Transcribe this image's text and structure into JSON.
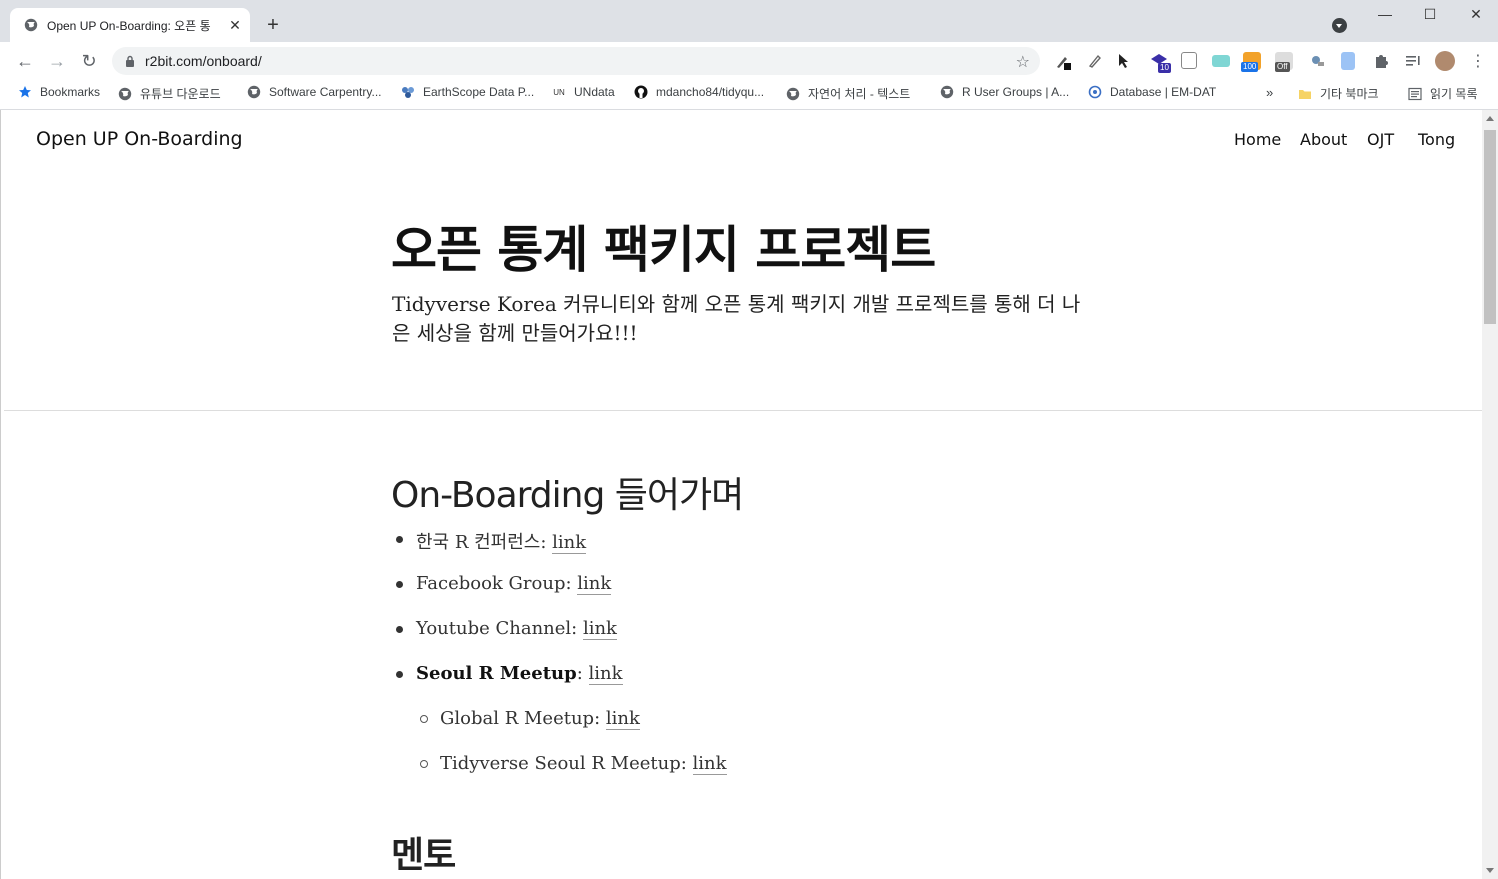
{
  "browser": {
    "tab_title": "Open UP On-Boarding: 오픈 통",
    "tab_close": "✕",
    "new_tab": "+",
    "url": "r2bit.com/onboard/",
    "window_controls": {
      "minimize": "—",
      "maximize": "☐",
      "close": "✕"
    },
    "nav": {
      "back": "←",
      "forward": "→",
      "reload": "↻"
    },
    "star": "☆",
    "extension_badges": {
      "ext4": "10",
      "ext7": "100",
      "ext8": "Off"
    },
    "bookmarks": [
      {
        "label": "Bookmarks",
        "icon": "star-icon"
      },
      {
        "label": "유튜브 다운로드",
        "icon": "globe-icon"
      },
      {
        "label": "Software Carpentry...",
        "icon": "globe-icon"
      },
      {
        "label": "EarthScope Data P...",
        "icon": "earthscope-icon"
      },
      {
        "label": "UNdata",
        "icon": "un-icon"
      },
      {
        "label": "mdancho84/tidyqu...",
        "icon": "github-icon"
      },
      {
        "label": "자연어 처리 - 텍스트",
        "icon": "globe-icon"
      },
      {
        "label": "R User Groups | A...",
        "icon": "globe-icon"
      },
      {
        "label": "Database | EM-DAT",
        "icon": "emdat-icon"
      }
    ],
    "bookmarks_more": "»",
    "other_bookmarks": "기타 북마크",
    "reading_list": "읽기 목록"
  },
  "site": {
    "title": "Open UP On-Boarding",
    "nav": [
      "Home",
      "About",
      "OJT",
      "Tong"
    ]
  },
  "hero": {
    "title": "오픈 통계 팩키지 프로젝트",
    "subtitle": "Tidyverse Korea 커뮤니티와 함께 오픈 통계 팩키지 개발 프로젝트를 통해 더 나은 세상을 함께 만들어가요!!!"
  },
  "section1": {
    "heading": "On-Boarding 들어가며",
    "items": [
      {
        "text": "한국 R 컨퍼런스: ",
        "link": "link"
      },
      {
        "text": "Facebook Group: ",
        "link": "link"
      },
      {
        "text": "Youtube Channel: ",
        "link": "link"
      },
      {
        "text": "Seoul R Meetup",
        "suffix": ": ",
        "link": "link"
      },
      {
        "text": "Global R Meetup: ",
        "link": "link"
      },
      {
        "text": "Tidyverse Seoul R Meetup: ",
        "link": "link"
      }
    ]
  },
  "section2": {
    "heading": "멘토"
  }
}
